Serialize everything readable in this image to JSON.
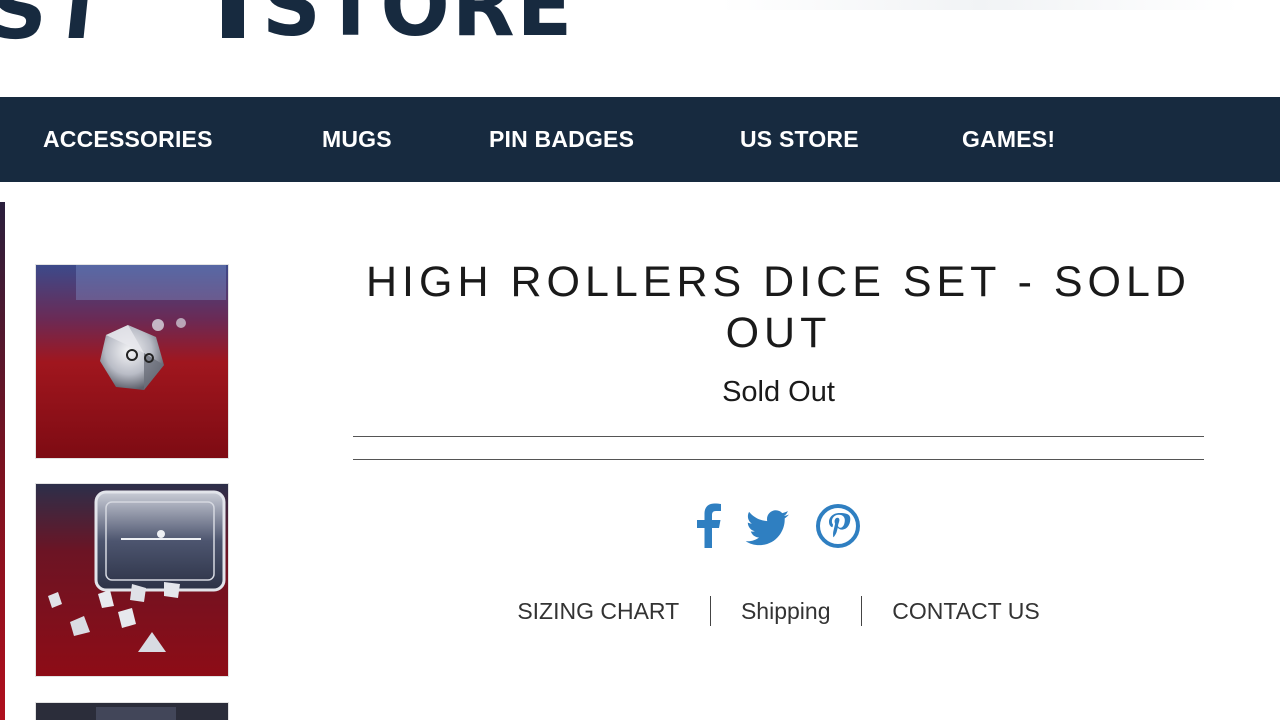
{
  "header": {
    "logo_left_text": "ST",
    "logo_store_text": "STORE"
  },
  "nav": {
    "items": [
      {
        "label": "ACCESSORIES"
      },
      {
        "label": "MUGS"
      },
      {
        "label": "PIN BADGES"
      },
      {
        "label": "US STORE"
      },
      {
        "label": "GAMES!"
      }
    ]
  },
  "product": {
    "title_line1": "HIGH ROLLERS DICE SET - SOLD",
    "title_line2": "OUT",
    "price_status": "Sold Out"
  },
  "share": {
    "icons": [
      "facebook-icon",
      "twitter-icon",
      "pinterest-icon"
    ],
    "color": "#2f7fc1"
  },
  "footer_links": {
    "sizing": "SIZING CHART",
    "shipping": "Shipping",
    "contact": "CONTACT US"
  },
  "colors": {
    "brand_navy": "#172a3f",
    "social_blue": "#2f7fc1"
  }
}
